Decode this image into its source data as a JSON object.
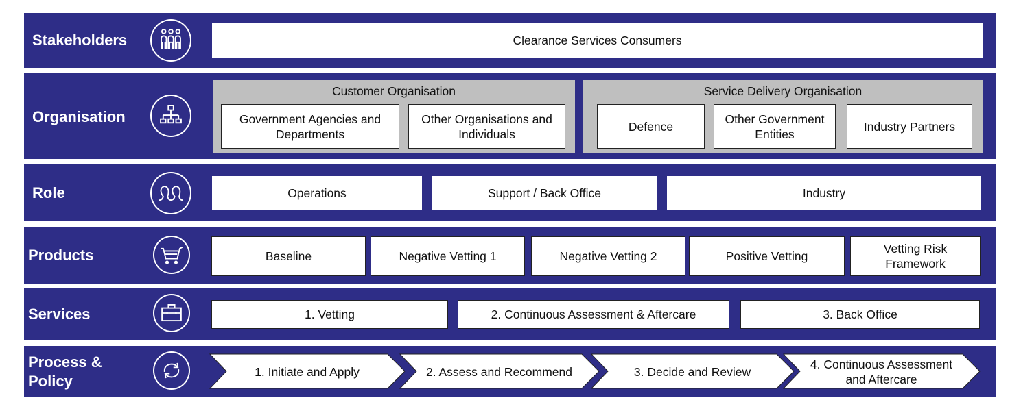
{
  "colors": {
    "band": "#2e2d87",
    "group": "#bfbfbf",
    "box": "#ffffff",
    "text": "#111111"
  },
  "stakeholders": {
    "label": "Stakeholders",
    "icon": "people-group-icon",
    "items": [
      "Clearance Services Consumers"
    ]
  },
  "organisation": {
    "label": "Organisation",
    "icon": "org-chart-icon",
    "groups": [
      {
        "title": "Customer Organisation",
        "items": [
          "Government Agencies and Departments",
          "Other Organisations and Individuals"
        ]
      },
      {
        "title": "Service Delivery Organisation",
        "items": [
          "Defence",
          "Other Government Entities",
          "Industry Partners"
        ]
      }
    ]
  },
  "role": {
    "label": "Role",
    "icon": "roles-icon",
    "items": [
      "Operations",
      "Support / Back Office",
      "Industry"
    ]
  },
  "products": {
    "label": "Products",
    "icon": "shopping-cart-icon",
    "items": [
      "Baseline",
      "Negative Vetting 1",
      "Negative Vetting 2",
      "Positive Vetting",
      "Vetting Risk Framework"
    ]
  },
  "services": {
    "label": "Services",
    "icon": "briefcase-icon",
    "items": [
      "1. Vetting",
      "2. Continuous Assessment & Aftercare",
      "3. Back Office"
    ]
  },
  "process": {
    "label": "Process & Policy",
    "label_line1": "Process &",
    "label_line2": "Policy",
    "icon": "refresh-cycle-icon",
    "steps": [
      "1. Initiate and Apply",
      "2. Assess and Recommend",
      "3. Decide and Review",
      "4. Continuous Assessment and Aftercare"
    ]
  }
}
